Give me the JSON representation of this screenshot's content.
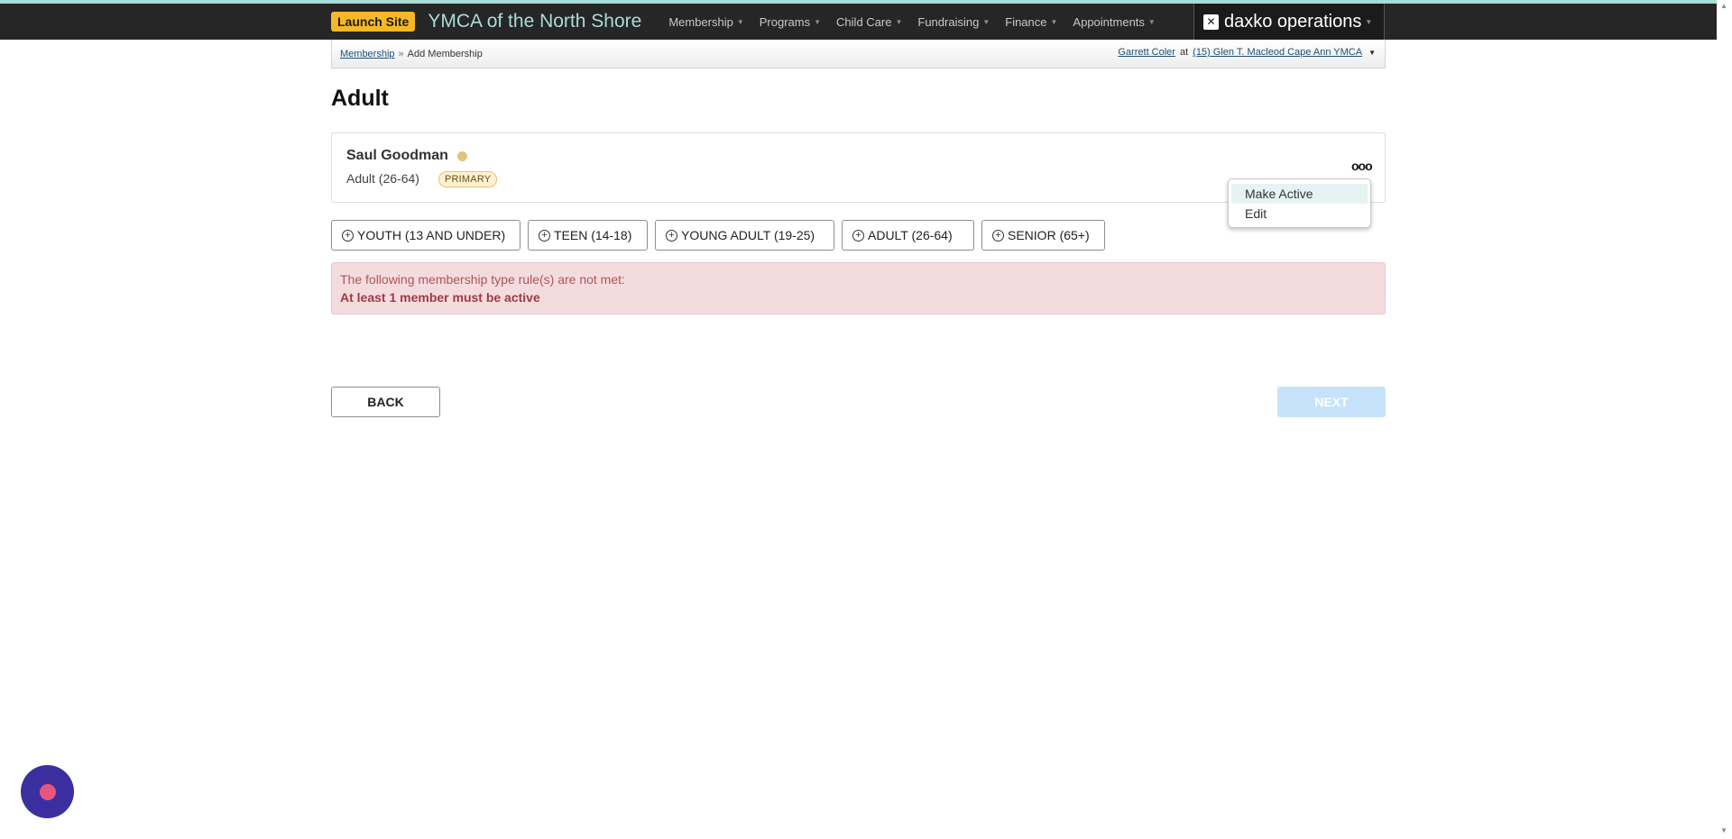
{
  "navbar": {
    "launch_label": "Launch Site",
    "brand": "YMCA of the North Shore",
    "items": [
      {
        "label": "Membership"
      },
      {
        "label": "Programs"
      },
      {
        "label": "Child Care"
      },
      {
        "label": "Fundraising"
      },
      {
        "label": "Finance"
      },
      {
        "label": "Appointments"
      }
    ],
    "product": "daxko operations"
  },
  "breadcrumb": {
    "parent": "Membership",
    "separator": "»",
    "current": "Add Membership"
  },
  "user": {
    "name": "Garrett Coler",
    "at": "at",
    "location": "(15) Glen T. Macleod Cape Ann YMCA"
  },
  "page": {
    "title": "Adult"
  },
  "member": {
    "name": "Saul Goodman",
    "age_group": "Adult (26-64)",
    "badge": "PRIMARY",
    "status_color": "#e3c47e"
  },
  "menu": {
    "items": [
      {
        "label": "Make Active"
      },
      {
        "label": "Edit"
      }
    ]
  },
  "type_buttons": [
    {
      "label": "YOUTH (13 AND UNDER)"
    },
    {
      "label": "TEEN (14-18)"
    },
    {
      "label": "YOUNG ADULT (19-25)"
    },
    {
      "label": "ADULT (26-64)"
    },
    {
      "label": "SENIOR (65+)"
    }
  ],
  "alert": {
    "message": "The following membership type rule(s) are not met:",
    "rule": "At least 1 member must be active"
  },
  "actions": {
    "back": "BACK",
    "next": "NEXT"
  },
  "colors": {
    "accent": "#a9dcd6",
    "launch": "#f6b824",
    "alert_bg": "#f4dcde",
    "next_disabled": "#c6e3fb",
    "chat": "#3b2fa0"
  }
}
